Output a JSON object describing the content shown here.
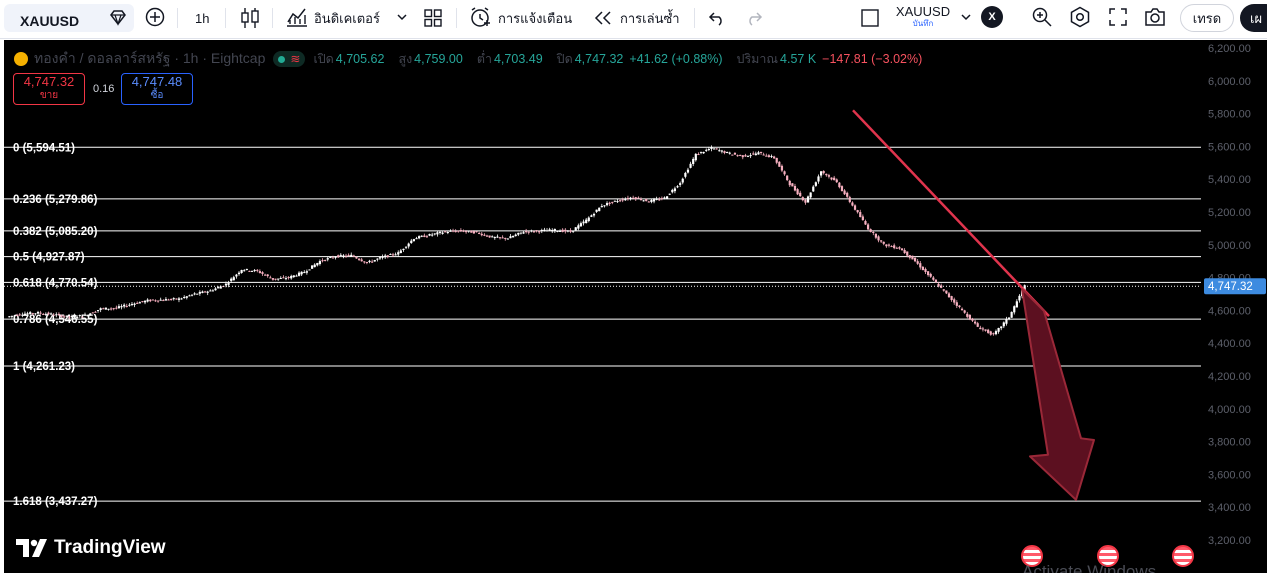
{
  "toolbar": {
    "symbol": "XAUUSD",
    "interval": "1h",
    "indicators_label": "อินดิเคเตอร์",
    "alerts_label": "การแจ้งเตือน",
    "replay_label": "การเล่นซ้ำ",
    "compare_symbol": "XAUUSD",
    "compare_sub": "บันทึก",
    "compare_close": "X",
    "trade_label": "เทรด",
    "publish_label": "เผ"
  },
  "legend": {
    "title": "ทองคำ / ดอลลาร์สหรัฐ · 1h · Eightcap",
    "open_label": "เปิด",
    "open": "4,705.62",
    "high_label": "สูง",
    "high": "4,759.00",
    "low_label": "ต่ำ",
    "low": "4,703.49",
    "close_label": "ปิด",
    "close": "4,747.32",
    "change": "+41.62 (+0.88%)",
    "volume_label": "ปริมาณ",
    "volume": "4.57 K",
    "volume_change": "−147.81 (−3.02%)"
  },
  "order": {
    "sell_price": "4,747.32",
    "sell_label": "ขาย",
    "spread": "0.16",
    "buy_price": "4,747.48",
    "buy_label": "ซื้อ"
  },
  "price_axis": {
    "ticks": [
      "6,200.00",
      "6,000.00",
      "5,800.00",
      "5,600.00",
      "5,400.00",
      "5,200.00",
      "5,000.00",
      "4,800.00",
      "4,600.00",
      "4,400.00",
      "4,200.00",
      "4,000.00",
      "3,800.00",
      "3,600.00",
      "3,400.00",
      "3,200.00"
    ],
    "current_price": "4,747.32"
  },
  "fib_levels": [
    {
      "label": "0 (5,594.51)",
      "price": 5594.51
    },
    {
      "label": "0.236 (5,279.86)",
      "price": 5279.86
    },
    {
      "label": "0.382 (5,085.20)",
      "price": 5085.2
    },
    {
      "label": "0.5 (4,927.87)",
      "price": 4927.87
    },
    {
      "label": "0.618 (4,770.54)",
      "price": 4770.54
    },
    {
      "label": "0.786 (4,546.55)",
      "price": 4546.55
    },
    {
      "label": "1 (4,261.23)",
      "price": 4261.23
    },
    {
      "label": "1.618 (3,437.27)",
      "price": 3437.27
    }
  ],
  "chart_data": {
    "type": "line",
    "symbol": "XAUUSD",
    "interval": "1h",
    "ylim": [
      3200,
      6200
    ],
    "series": [
      {
        "values": [
          4560,
          4580,
          4585,
          4575,
          4560,
          4570,
          4610,
          4615,
          4640,
          4660,
          4665,
          4670,
          4700,
          4720,
          4760,
          4850,
          4840,
          4790,
          4800,
          4835,
          4900,
          4930,
          4935,
          4890,
          4925,
          4950,
          5040,
          5060,
          5080,
          5085,
          5075,
          5045,
          5040,
          5080,
          5085,
          5090,
          5080,
          5150,
          5240,
          5270,
          5290,
          5265,
          5285,
          5380,
          5550,
          5590,
          5560,
          5540,
          5560,
          5530,
          5370,
          5260,
          5450,
          5380,
          5240,
          5100,
          5000,
          4980,
          4900,
          4800,
          4700,
          4600,
          4500,
          4450,
          4560,
          4750
        ]
      }
    ],
    "current_price": 4747.32
  },
  "colors": {
    "up": "#ffffff",
    "down": "#f7b0c0",
    "trendline": "#e0344d",
    "arrow_fill": "#5c1020",
    "arrow_stroke": "#9a2838",
    "fib_line": "#ffffff",
    "price_label_bg": "#3d8be0"
  },
  "branding": {
    "logo_text": "TradingView"
  },
  "watermark": "Activate Windows"
}
